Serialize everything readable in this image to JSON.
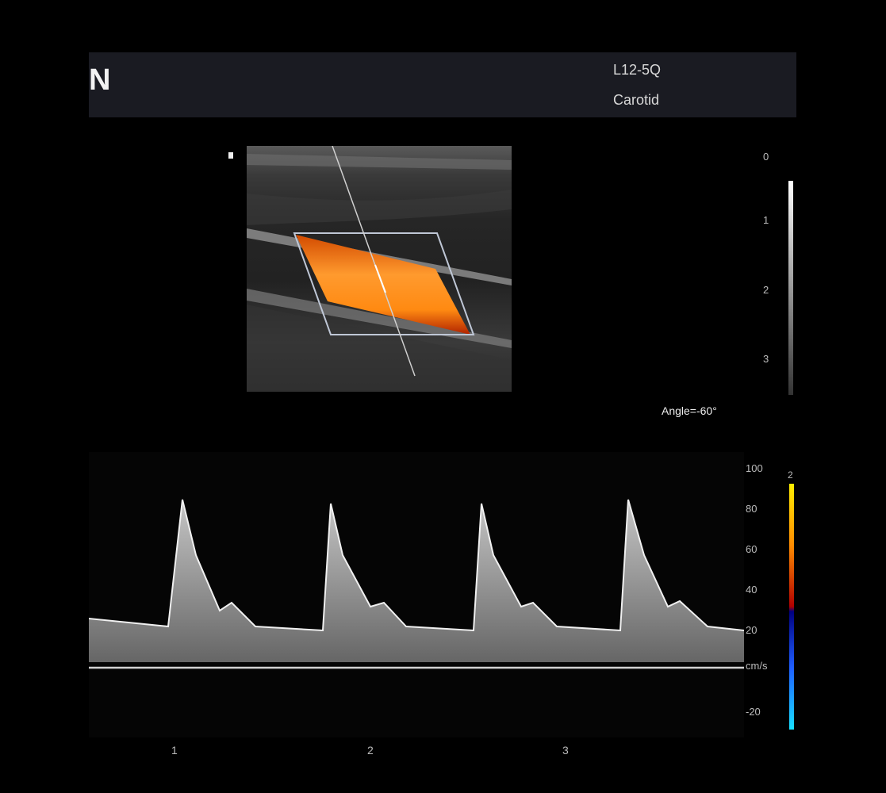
{
  "header": {
    "logo_text": "N",
    "probe": "L12-5Q",
    "preset": "Carotid"
  },
  "bmode": {
    "depth_scale": [
      "0",
      "1",
      "2",
      "3"
    ],
    "angle_label": "Angle=-60°"
  },
  "doppler": {
    "velocity_scale": [
      "100",
      "80",
      "60",
      "40",
      "20",
      "cm/s",
      "-20"
    ],
    "time_ticks": [
      "1",
      "2",
      "3"
    ],
    "color_scale_top": "2"
  },
  "colors": {
    "header_bg": "#1a1b22",
    "flow": "#ff8c1a",
    "background": "#000000"
  }
}
